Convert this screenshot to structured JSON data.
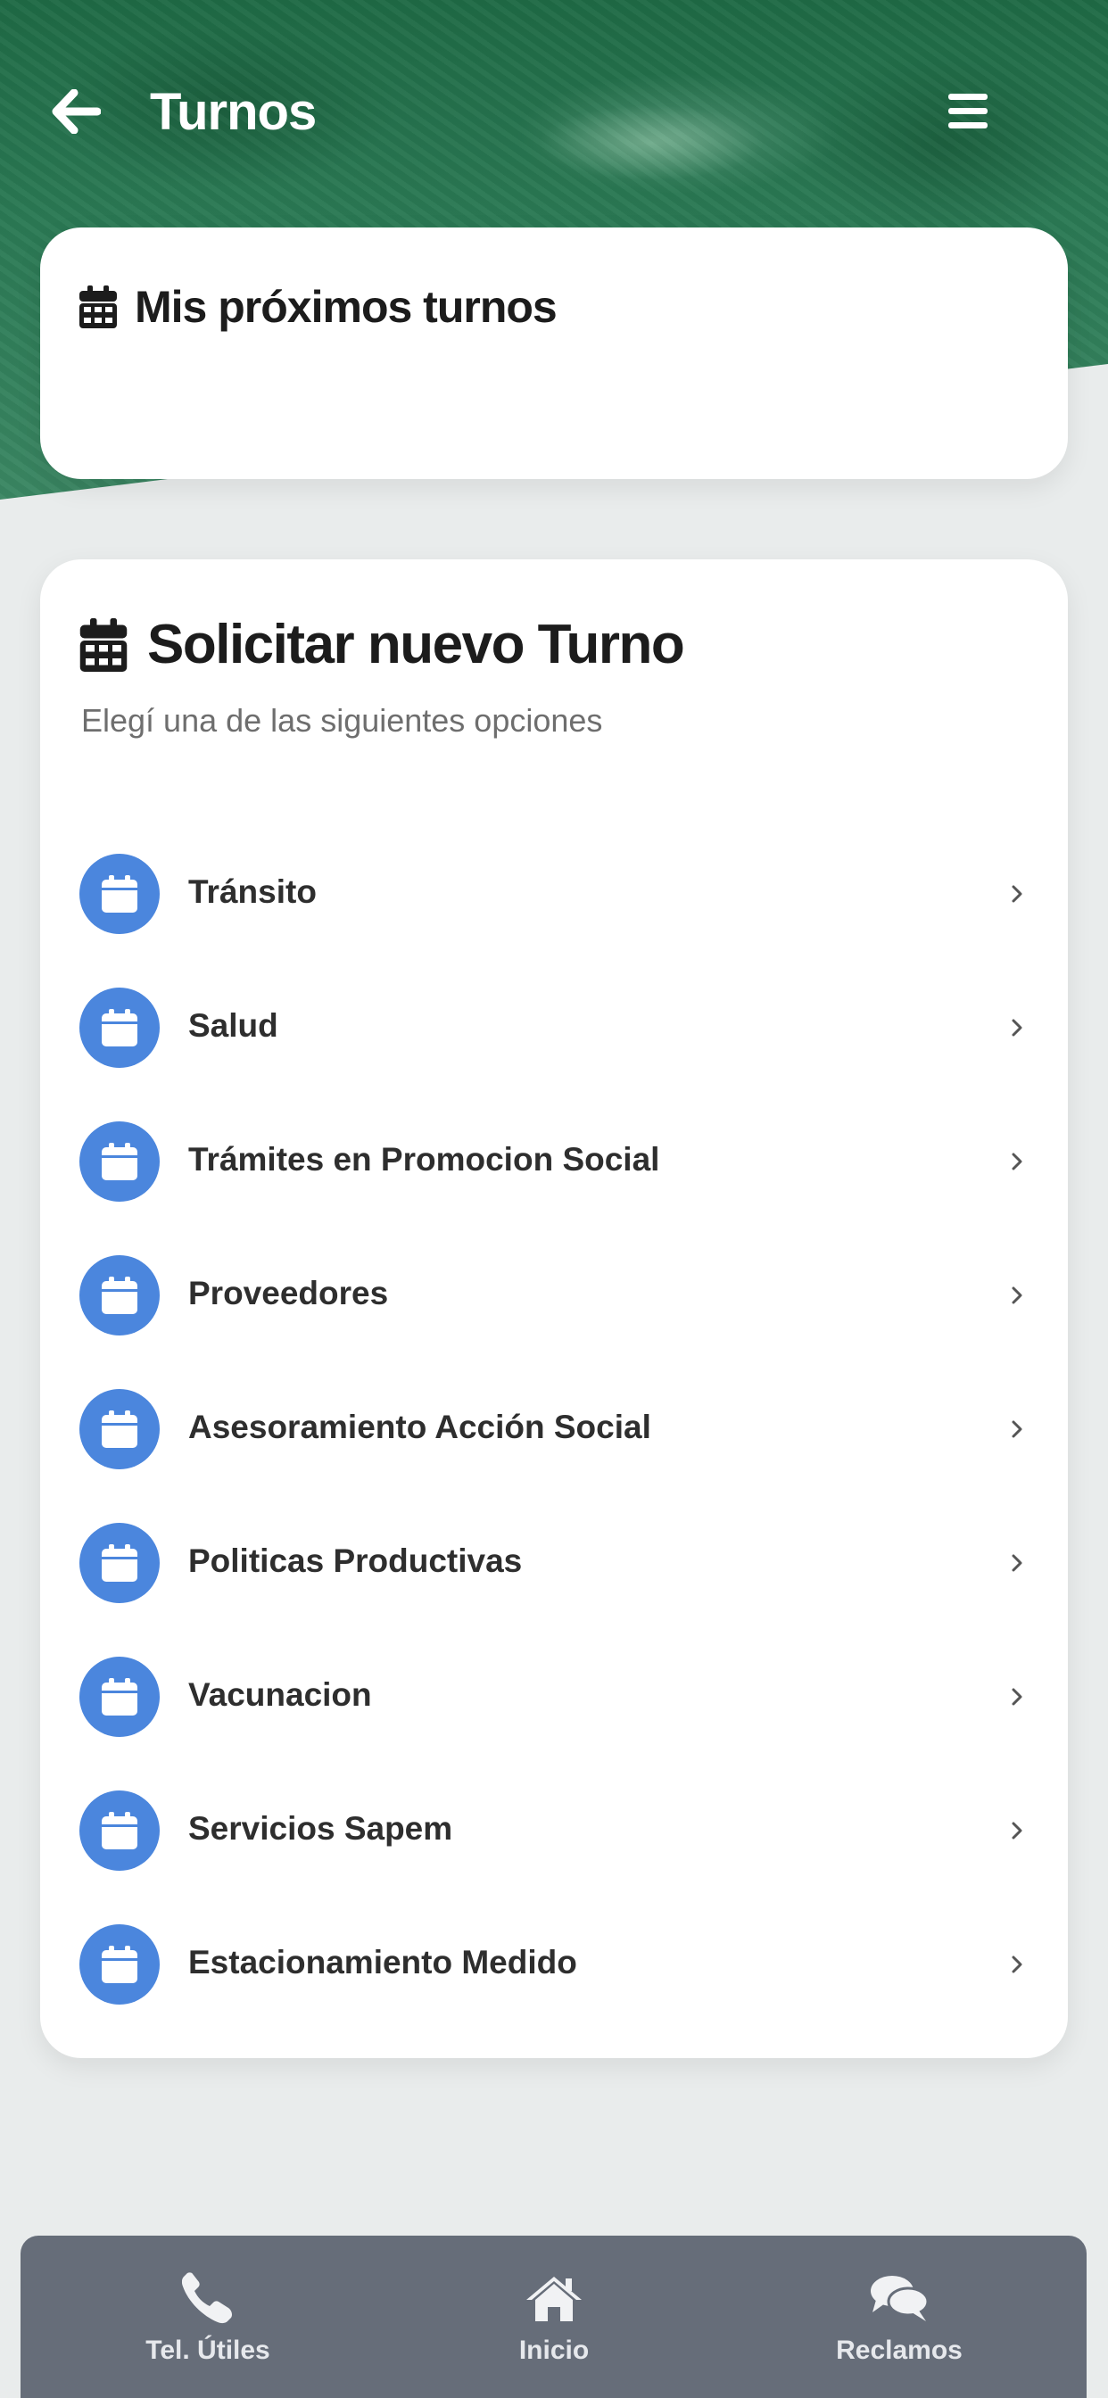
{
  "header": {
    "title": "Turnos",
    "back_icon": "arrow-left-icon",
    "menu_icon": "hamburger-menu-icon"
  },
  "upcoming": {
    "title": "Mis próximos turnos",
    "icon": "calendar-icon"
  },
  "new_appointment": {
    "title": "Solicitar nuevo Turno",
    "subtitle": "Elegí una de las siguientes opciones",
    "icon": "calendar-icon",
    "items": [
      {
        "label": "Tránsito"
      },
      {
        "label": "Salud"
      },
      {
        "label": "Trámites en Promocion Social"
      },
      {
        "label": "Proveedores"
      },
      {
        "label": "Asesoramiento Acción Social"
      },
      {
        "label": "Politicas Productivas"
      },
      {
        "label": "Vacunacion"
      },
      {
        "label": "Servicios Sapem"
      },
      {
        "label": "Estacionamiento Medido"
      }
    ]
  },
  "bottom_nav": {
    "tel_label": "Tel. Útiles",
    "home_label": "Inicio",
    "claims_label": "Reclamos"
  },
  "colors": {
    "accent": "#4b86dd",
    "header_green": "#2b7a55",
    "nav_bg": "#666d79"
  }
}
